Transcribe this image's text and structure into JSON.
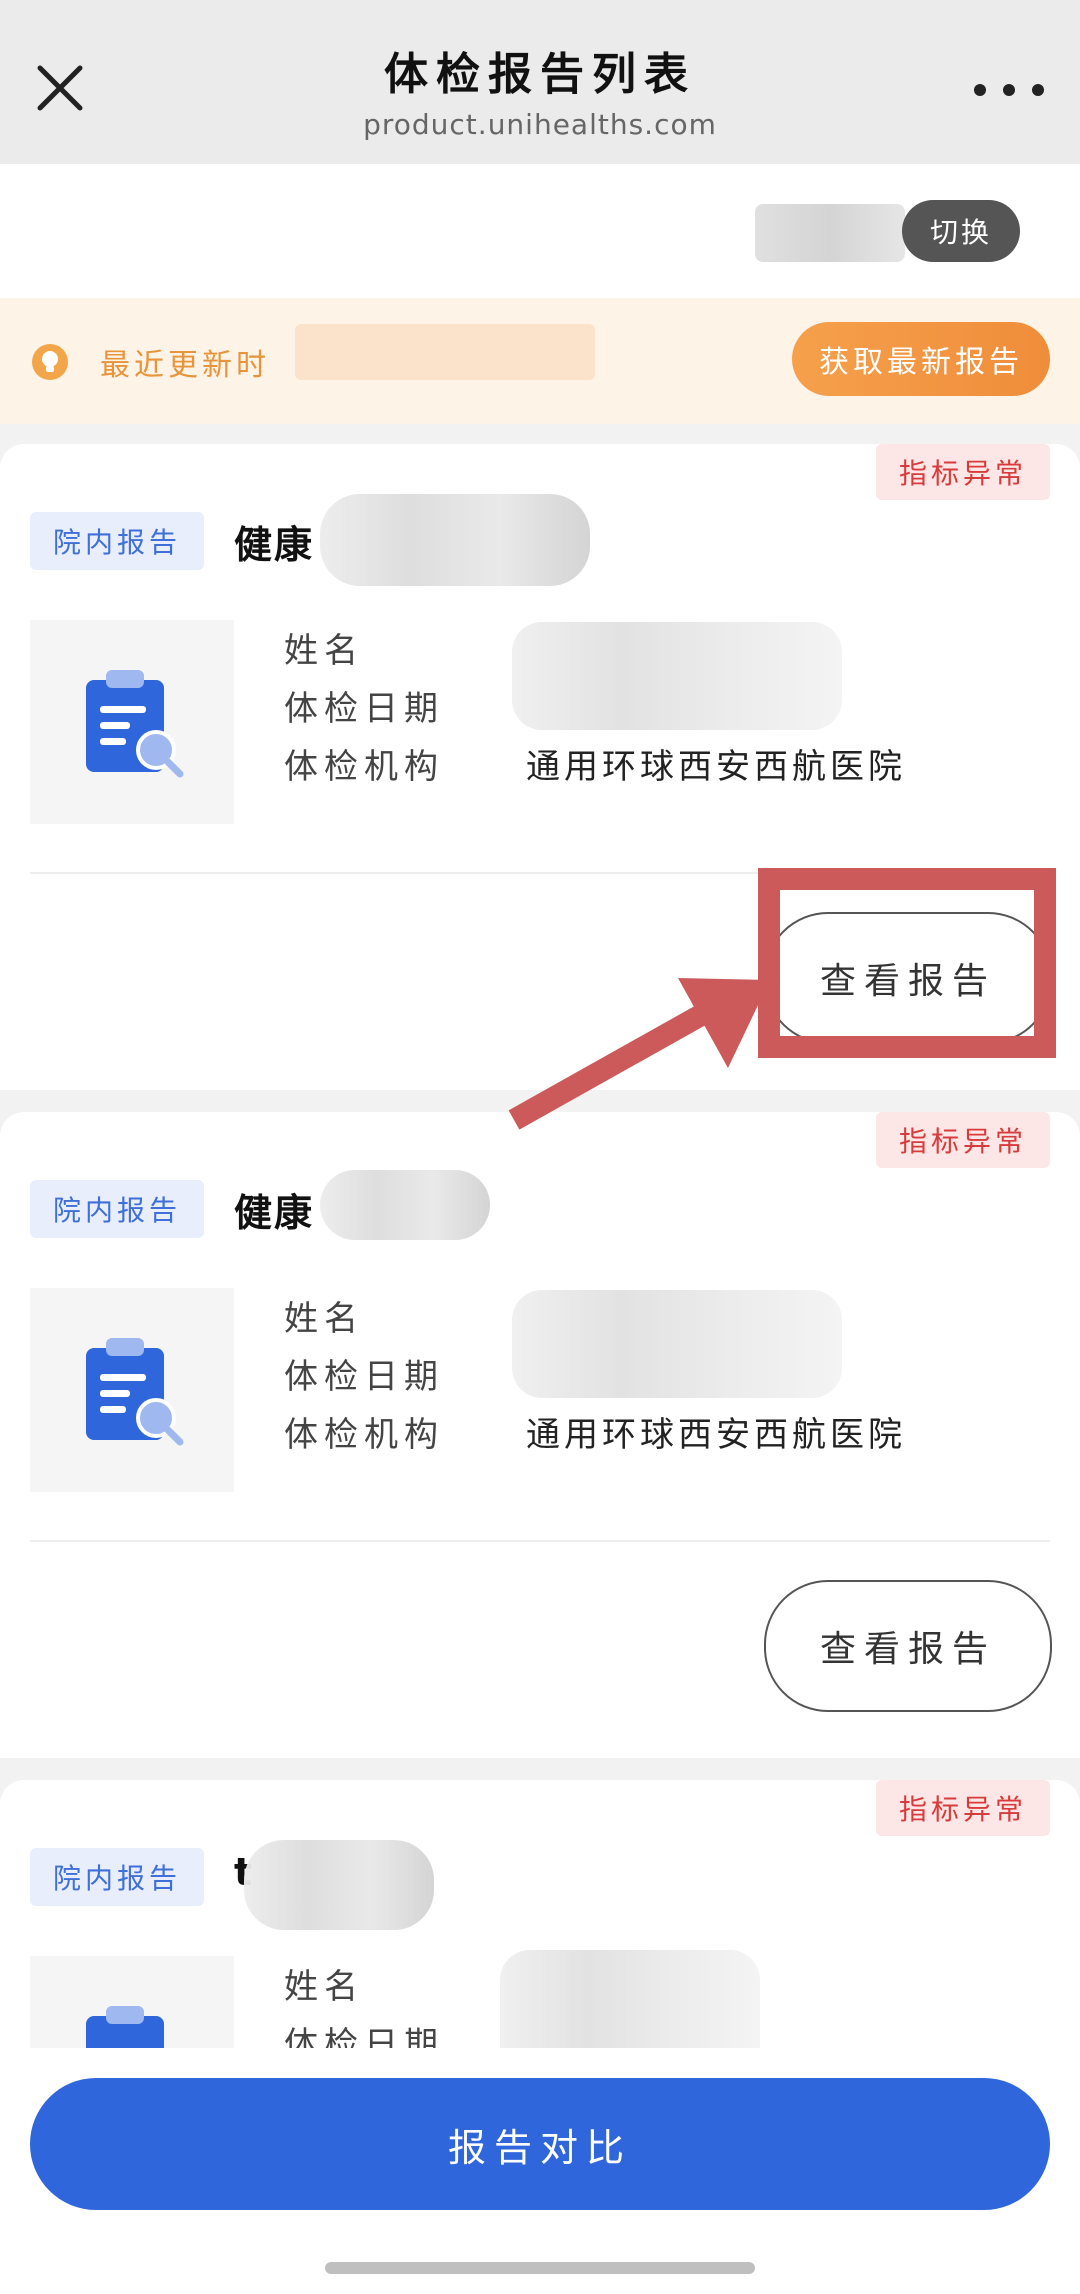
{
  "header": {
    "title": "体检报告列表",
    "url": "product.unihealths.com"
  },
  "switch": {
    "label": "切换"
  },
  "update": {
    "label": "最近更新时",
    "fetch_button": "获取最新报告"
  },
  "reports": [
    {
      "abnormal_tag": "指标异常",
      "type_tag": "院内报告",
      "name": "健康",
      "label_name": "姓名",
      "label_date": "体检日期",
      "label_org": "体检机构",
      "org": "通用环球西安西航医院",
      "view_button": "查看报告"
    },
    {
      "abnormal_tag": "指标异常",
      "type_tag": "院内报告",
      "name": "健康",
      "label_name": "姓名",
      "label_date": "体检日期",
      "label_org": "体检机构",
      "org": "通用环球西安西航医院",
      "view_button": "查看报告"
    },
    {
      "abnormal_tag": "指标异常",
      "type_tag": "院内报告",
      "name": "t",
      "label_name": "姓名",
      "label_date": "体检日期"
    }
  ],
  "bottom": {
    "compare_button": "报告对比"
  },
  "colors": {
    "primary": "#2f66dc",
    "orange": "#ef8d3a",
    "abnormal": "#d83b3b",
    "annotation": "#cc5a5a"
  }
}
